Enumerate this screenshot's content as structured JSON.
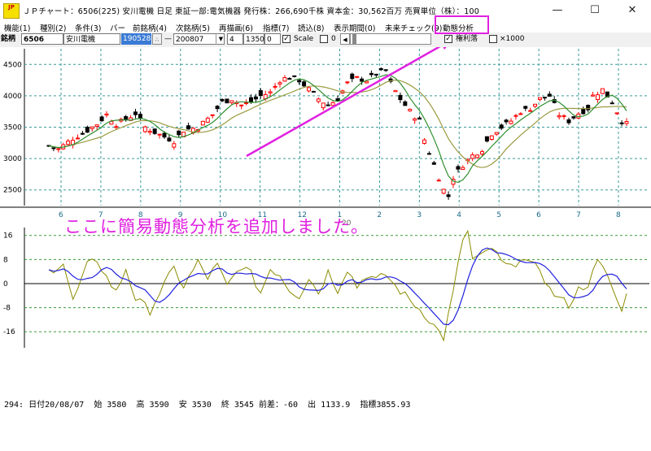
{
  "window": {
    "icon_text": "JP",
    "title": "ＪＰチャート：6506(225) 安川電機  日足  東証一部:電気機器  発行株：266,690千株  資本金：30,562百万  売買単位（株）：100",
    "minimize": "—",
    "maximize": "☐",
    "close": "✕"
  },
  "menu": [
    {
      "label": "機能(1)"
    },
    {
      "label": "種別(2)"
    },
    {
      "label": "条件(3)"
    },
    {
      "label": "バー"
    },
    {
      "label": "前銘柄(4)"
    },
    {
      "label": "次銘柄(5)"
    },
    {
      "label": "再描画(6)"
    },
    {
      "label": "指標(7)"
    },
    {
      "label": "読込(8)"
    },
    {
      "label": "表示期間(0)"
    },
    {
      "label": "未来チェック(9)"
    },
    {
      "label": "動態分析"
    }
  ],
  "toolbar": {
    "code_label": "銘柄",
    "code": "6506",
    "name": "安川電機",
    "date_code": "190528",
    "dash": "—",
    "start": "200807",
    "period": "4",
    "value1": "1350",
    "value2": "0",
    "scale_label": "Scale",
    "zero_label": "0",
    "rights_label": "権利落",
    "x1000_label": "×1000"
  },
  "chart_data": {
    "type": "candlestick",
    "price_axis": {
      "ticks": [
        "4500",
        "4000",
        "3500",
        "3000",
        "2500"
      ],
      "ylim": [
        2250,
        4750
      ]
    },
    "month_ticks": [
      "6",
      "7",
      "8",
      "9",
      "10",
      "11",
      "12",
      "1",
      "2",
      "3",
      "4",
      "5",
      "6",
      "7",
      "8"
    ],
    "year_label": "20",
    "osc_axis": {
      "ticks": [
        "16",
        "8",
        "0",
        "-8",
        "-16"
      ],
      "ylim": [
        -20,
        17
      ]
    },
    "colors": {
      "up": "#ff0000",
      "down": "#000000",
      "ma_short": "#2f8f2f",
      "ma_long": "#9a9a40",
      "osc_raw": "#8b8b00",
      "osc_smooth": "#2020e0",
      "grid": "#3a9a9a"
    },
    "close_path": [
      [
        0,
        3200
      ],
      [
        2,
        3150
      ],
      [
        5,
        3320
      ],
      [
        7,
        3400
      ],
      [
        10,
        3550
      ],
      [
        12,
        3700
      ],
      [
        14,
        3550
      ],
      [
        16,
        3620
      ],
      [
        18,
        3720
      ],
      [
        20,
        3500
      ],
      [
        23,
        3380
      ],
      [
        26,
        3280
      ],
      [
        28,
        3450
      ],
      [
        31,
        3500
      ],
      [
        34,
        3700
      ],
      [
        36,
        3900
      ],
      [
        38,
        3950
      ],
      [
        40,
        3850
      ],
      [
        42,
        3900
      ],
      [
        44,
        4000
      ],
      [
        46,
        4050
      ],
      [
        48,
        4250
      ],
      [
        50,
        4300
      ],
      [
        52,
        4250
      ],
      [
        54,
        4100
      ],
      [
        56,
        3950
      ],
      [
        58,
        3850
      ],
      [
        60,
        3950
      ],
      [
        62,
        4200
      ],
      [
        64,
        4280
      ],
      [
        66,
        4250
      ],
      [
        68,
        4350
      ],
      [
        70,
        4400
      ],
      [
        71,
        4200
      ],
      [
        73,
        3950
      ],
      [
        75,
        3750
      ],
      [
        77,
        3600
      ],
      [
        78,
        3300
      ],
      [
        80,
        2900
      ],
      [
        82,
        2500
      ],
      [
        83,
        2400
      ],
      [
        84,
        2700
      ],
      [
        86,
        2900
      ],
      [
        88,
        3050
      ],
      [
        90,
        3150
      ],
      [
        92,
        3400
      ],
      [
        94,
        3500
      ],
      [
        96,
        3600
      ],
      [
        98,
        3750
      ],
      [
        100,
        3800
      ],
      [
        102,
        3950
      ],
      [
        104,
        4000
      ],
      [
        106,
        3700
      ],
      [
        108,
        3600
      ],
      [
        110,
        3720
      ],
      [
        112,
        3800
      ],
      [
        113,
        4000
      ],
      [
        115,
        4100
      ],
      [
        117,
        3900
      ],
      [
        118,
        3750
      ],
      [
        119,
        3600
      ],
      [
        120,
        3550
      ]
    ],
    "osc_raw_path": [
      [
        0,
        4
      ],
      [
        3,
        7
      ],
      [
        5,
        -6
      ],
      [
        8,
        6
      ],
      [
        10,
        8
      ],
      [
        12,
        2
      ],
      [
        14,
        -3
      ],
      [
        16,
        5
      ],
      [
        18,
        -5
      ],
      [
        21,
        -9
      ],
      [
        23,
        -3
      ],
      [
        26,
        5
      ],
      [
        28,
        -1
      ],
      [
        31,
        7
      ],
      [
        33,
        2
      ],
      [
        35,
        6
      ],
      [
        37,
        -1
      ],
      [
        40,
        6
      ],
      [
        42,
        3
      ],
      [
        44,
        -3
      ],
      [
        46,
        5
      ],
      [
        48,
        3
      ],
      [
        50,
        -2
      ],
      [
        52,
        -4
      ],
      [
        54,
        2
      ],
      [
        56,
        -3
      ],
      [
        58,
        4
      ],
      [
        60,
        -2
      ],
      [
        62,
        5
      ],
      [
        64,
        -1
      ],
      [
        66,
        3
      ],
      [
        68,
        1
      ],
      [
        70,
        3
      ],
      [
        72,
        -1
      ],
      [
        74,
        -4
      ],
      [
        76,
        -7
      ],
      [
        78,
        -10
      ],
      [
        80,
        -14
      ],
      [
        82,
        -18
      ],
      [
        84,
        -3
      ],
      [
        86,
        15
      ],
      [
        87,
        17
      ],
      [
        88,
        8
      ],
      [
        90,
        9
      ],
      [
        92,
        12
      ],
      [
        94,
        7
      ],
      [
        96,
        5
      ],
      [
        98,
        9
      ],
      [
        100,
        6
      ],
      [
        102,
        5
      ],
      [
        104,
        -2
      ],
      [
        106,
        -5
      ],
      [
        108,
        -7
      ],
      [
        110,
        -2
      ],
      [
        112,
        0
      ],
      [
        114,
        7
      ],
      [
        116,
        3
      ],
      [
        118,
        -6
      ],
      [
        119,
        -8
      ],
      [
        120,
        -4
      ]
    ],
    "status": {
      "index": "294:",
      "date": "日付20/08/07",
      "open_label": "始",
      "open": "3580",
      "high_label": "高",
      "high": "3590",
      "low_label": "安",
      "low": "3530",
      "close_label": "終",
      "close": "3545",
      "change_label": "前差：",
      "change": "-60",
      "volume_label": "出",
      "volume": "1133.9",
      "index_label": "指標",
      "index_value": "3855.93"
    }
  },
  "annotation": {
    "text": "ここに簡易動態分析を追加しました。",
    "color": "#e020e0"
  }
}
